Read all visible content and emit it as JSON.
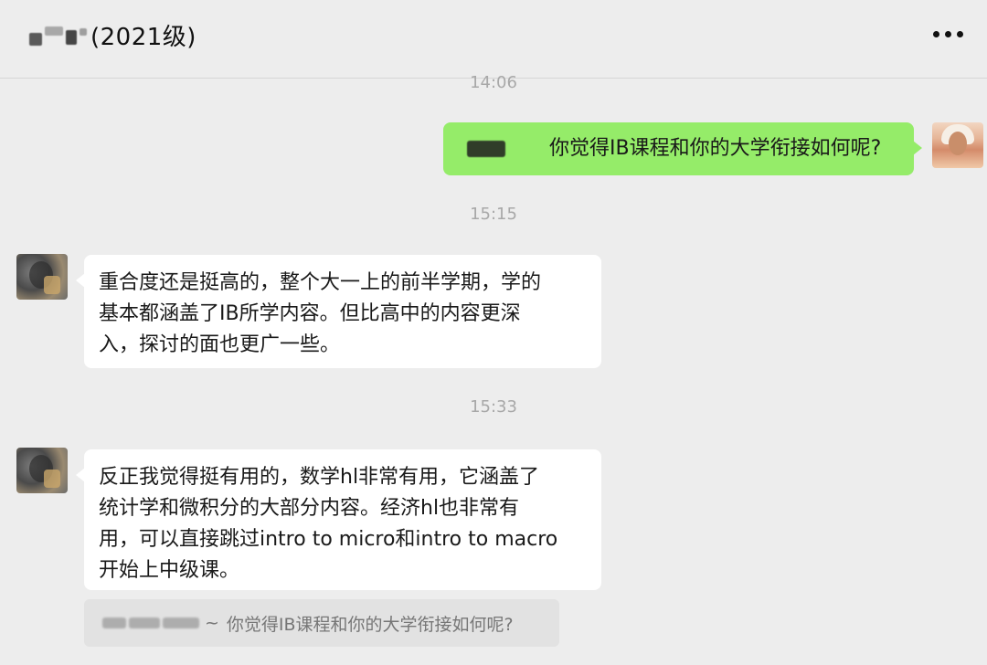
{
  "header": {
    "title": "(2021级)",
    "more_icon": "more-dots-icon"
  },
  "messages": [
    {
      "time": "14:06"
    },
    {
      "sender": "me",
      "text": "你觉得IB课程和你的大学衔接如何呢?"
    },
    {
      "time": "15:15"
    },
    {
      "sender": "other",
      "lines": [
        "重合度还是挺高的，整个大一上的前半学期，学的",
        "基本都涵盖了IB所学内容。但比高中的内容更深",
        "入，探讨的面也更广一些。"
      ]
    },
    {
      "time": "15:33"
    },
    {
      "sender": "other",
      "lines": [
        "反正我觉得挺有用的，数学hl非常有用，它涵盖了",
        "统计学和微积分的大部分内容。经济hl也非常有",
        "用，可以直接跳过intro to micro和intro to macro",
        "开始上中级课。"
      ]
    }
  ],
  "quote": {
    "suffix": "~",
    "text": "你觉得IB课程和你的大学衔接如何呢?"
  },
  "colors": {
    "background": "#ededed",
    "my_bubble": "#95ec69",
    "their_bubble": "#ffffff",
    "timestamp": "#a8a8a8"
  }
}
